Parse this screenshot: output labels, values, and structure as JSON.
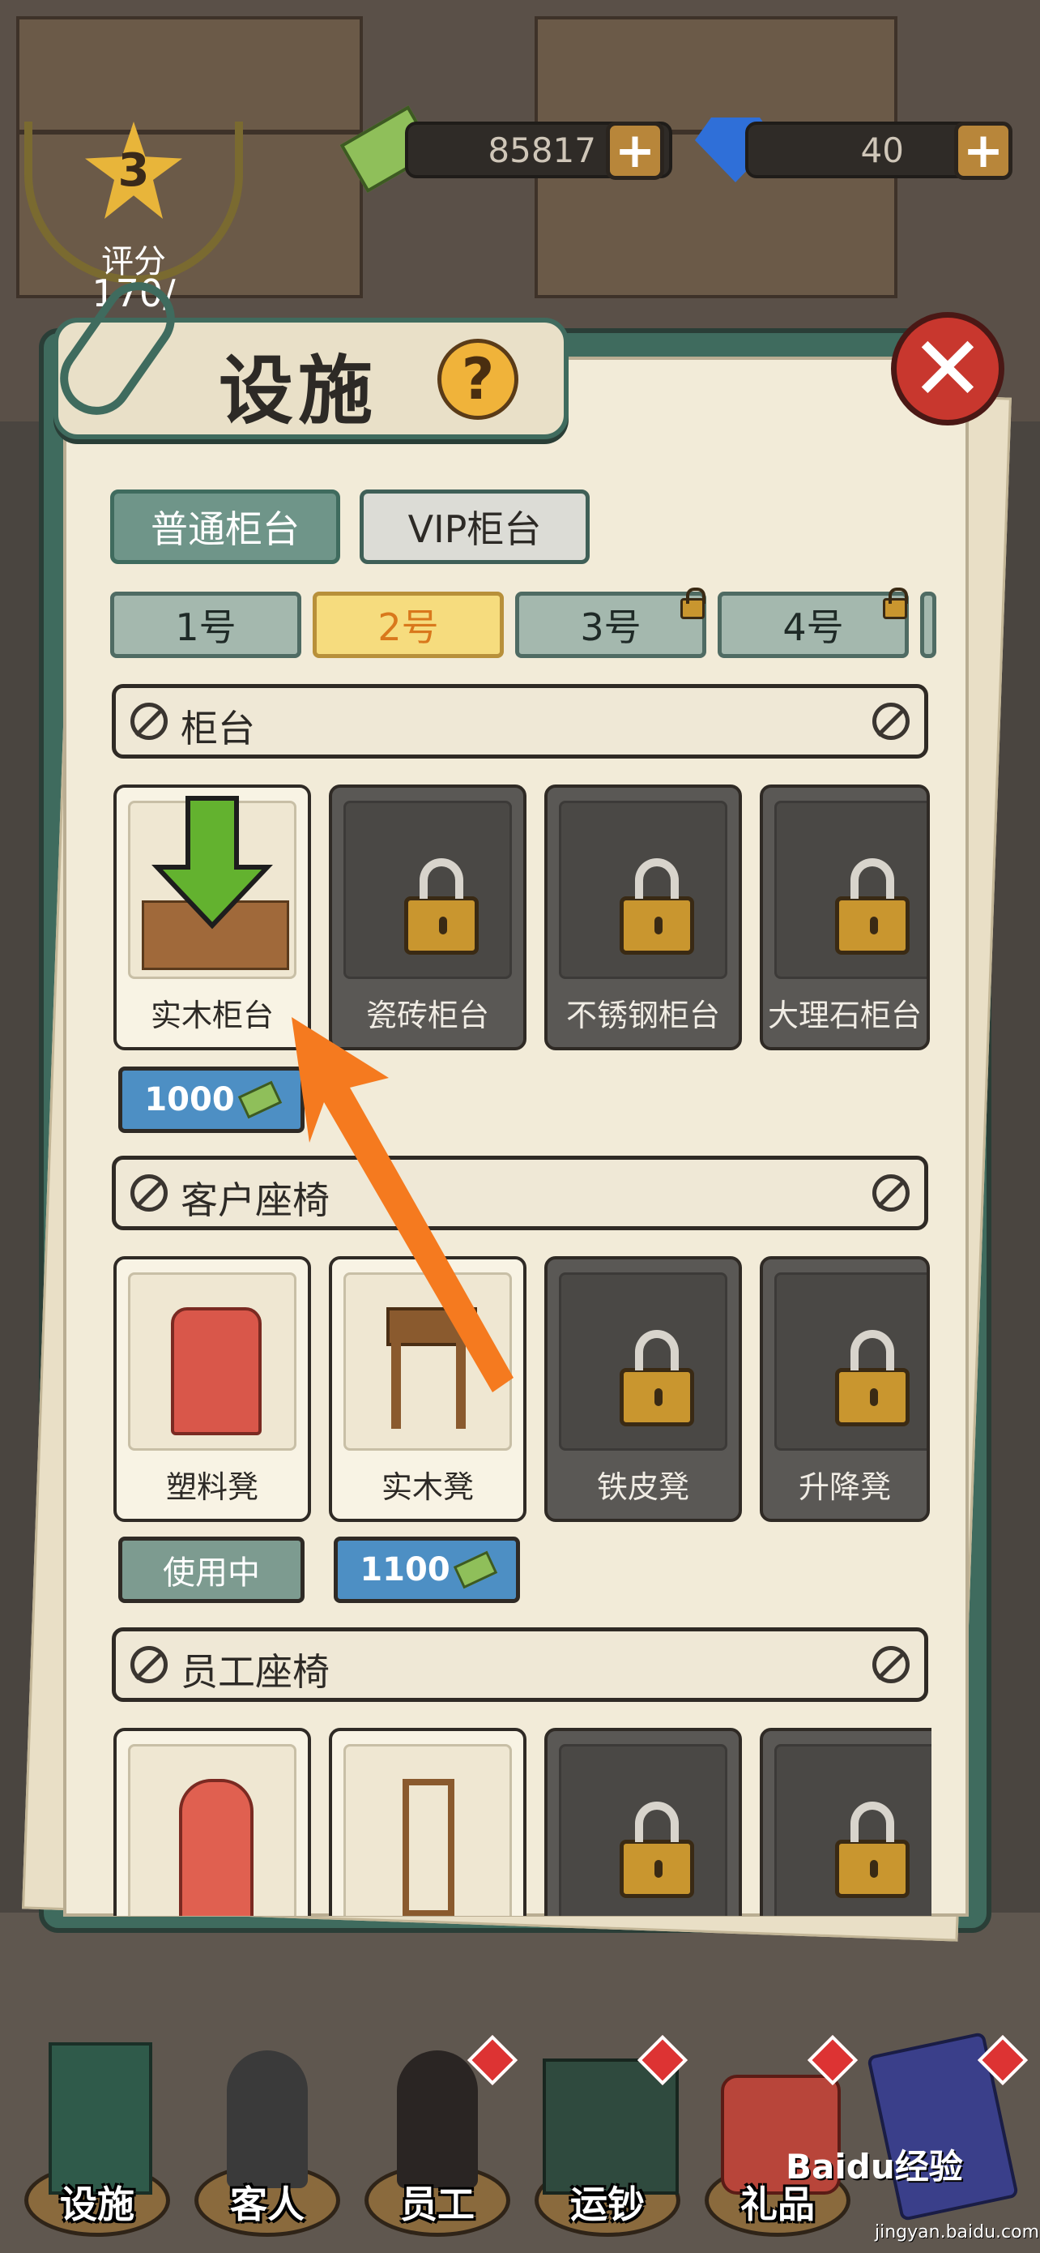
{
  "hud": {
    "money": "85817",
    "gems": "40",
    "rating_value": "3",
    "rating_label": "评分",
    "rating_progress": "170/"
  },
  "panel": {
    "title": "设施",
    "help": "?",
    "close": "✕"
  },
  "counter_tabs": [
    {
      "label": "普通柜台",
      "active": true
    },
    {
      "label": "VIP柜台",
      "active": false
    }
  ],
  "number_tabs": [
    {
      "label": "1号",
      "selected": false,
      "locked": false
    },
    {
      "label": "2号",
      "selected": true,
      "locked": false
    },
    {
      "label": "3号",
      "selected": false,
      "locked": true
    },
    {
      "label": "4号",
      "selected": false,
      "locked": true
    }
  ],
  "sections": [
    {
      "title": "柜台",
      "items": [
        {
          "name": "实木柜台",
          "locked": false,
          "price": "1000",
          "status": ""
        },
        {
          "name": "瓷砖柜台",
          "locked": true
        },
        {
          "name": "不锈钢柜台",
          "locked": true
        },
        {
          "name": "大理石柜台",
          "locked": true
        }
      ]
    },
    {
      "title": "客户座椅",
      "items": [
        {
          "name": "塑料凳",
          "locked": false,
          "status": "使用中"
        },
        {
          "name": "实木凳",
          "locked": false,
          "price": "1100"
        },
        {
          "name": "铁皮凳",
          "locked": true
        },
        {
          "name": "升降凳",
          "locked": true
        }
      ]
    },
    {
      "title": "员工座椅",
      "items": [
        {
          "name": "",
          "locked": false
        },
        {
          "name": "",
          "locked": false
        },
        {
          "name": "",
          "locked": true
        },
        {
          "name": "",
          "locked": true
        }
      ]
    }
  ],
  "bottom_nav": [
    {
      "label": "设施",
      "badge": false
    },
    {
      "label": "客人",
      "badge": false
    },
    {
      "label": "员工",
      "badge": true
    },
    {
      "label": "运钞",
      "badge": true
    },
    {
      "label": "礼品",
      "badge": true
    },
    {
      "label": "",
      "badge": true
    }
  ],
  "watermark": {
    "brand": "Baidu经验",
    "url": "jingyan.baidu.com"
  },
  "colors": {
    "panel_green": "#3f6b5e",
    "paper": "#f2ebd8",
    "selected_tab": "#f6dc7e",
    "price_blue": "#4d8fc4",
    "arrow_orange": "#f57a1f",
    "arrow_green": "#63b22f",
    "close_red": "#c8372e"
  }
}
